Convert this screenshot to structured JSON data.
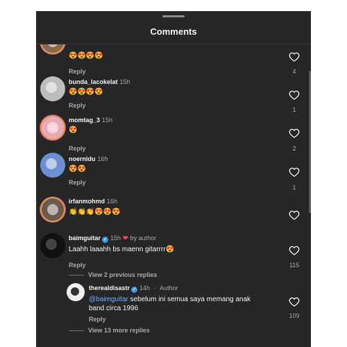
{
  "header": {
    "title": "Comments"
  },
  "comments": [
    {
      "username": "",
      "time": "",
      "text": "😍😍😍😍",
      "reply": "Reply",
      "likes": "4"
    },
    {
      "username": "bunda_lacokelat",
      "time": "15h",
      "text": "😍😍😍😍",
      "reply": "Reply",
      "likes": "1"
    },
    {
      "username": "momtag_3",
      "time": "15h",
      "text": "😍",
      "reply": "Reply",
      "likes": "2"
    },
    {
      "username": "noernidu",
      "time": "16h",
      "text": "😍😍",
      "reply": "Reply",
      "likes": "1"
    },
    {
      "username": "irfanmohmd",
      "time": "16h",
      "text": "👏👏👏😍😍😍",
      "reply": "Reply",
      "likes": ""
    },
    {
      "username": "baimguitar",
      "time": "15h",
      "byline": "by author",
      "text": "Laahh laaahh bs maenn gitarrrr😍",
      "reply": "Reply",
      "likes": "115"
    }
  ],
  "view_previous": "View 2 previous replies",
  "reply_comment": {
    "username": "therealdisastr",
    "time": "14h",
    "byline": "Author",
    "mention": "@baimguitar",
    "text": " sebelum ini semua saya memang anak band circa 1996",
    "reply": "Reply",
    "likes": "109"
  },
  "view_more": "View 13 more replies",
  "colors": {
    "background": "#262626",
    "text": "#f5f5f5",
    "muted": "#a8a8a8",
    "verified": "#3897f0",
    "mention": "#76a9ff",
    "like_red": "#ed4956"
  },
  "icons": {
    "like": "heart-outline-icon",
    "verified": "verified-badge-icon",
    "author_like": "red-heart-icon"
  }
}
